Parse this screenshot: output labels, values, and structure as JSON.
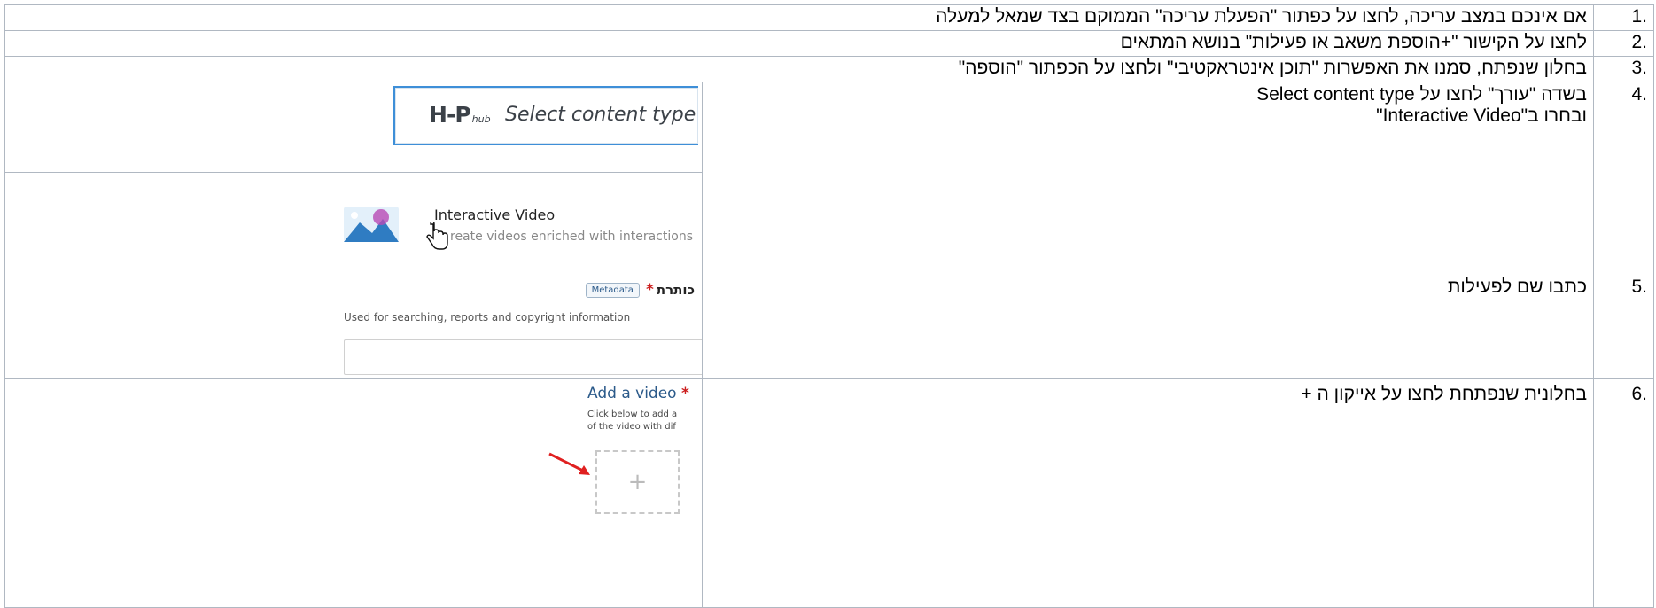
{
  "steps": [
    {
      "number": "1.",
      "text": "אם אינכם במצב עריכה, לחצו על כפתור \"הפעלת עריכה\" הממוקם בצד שמאל למעלה"
    },
    {
      "number": "2.",
      "text": "לחצו על הקישור \"+הוספת משאב או פעילות\" בנושא המתאים"
    },
    {
      "number": "3.",
      "text": "בחלון שנפתח, סמנו את האפשרות \"תוכן אינטראקטיבי\" ולחצו על הכפתור \"הוספה\""
    },
    {
      "number": "4.",
      "text_line1": "בשדה \"עורך\" לחצו על Select content type",
      "text_line2": "ובחרו ב\"Interactive Video\""
    },
    {
      "number": "5.",
      "text": "כתבו שם לפעילות"
    },
    {
      "number": "6.",
      "text": "בחלונית שנפתחת לחצו על אייקון ה +"
    }
  ],
  "screenshots": {
    "hub": {
      "logo_h": "H",
      "logo_p": "P",
      "logo_sub": "hub",
      "select_text": "Select content type"
    },
    "iv": {
      "title": "Interactive Video",
      "desc": "reate videos enriched with interactions"
    },
    "title_field": {
      "label": "כותרת",
      "required": "*",
      "badge": "Metadata",
      "help": "Used for searching, reports and copyright information"
    },
    "video": {
      "label": "Add a video",
      "required": "*",
      "line1": "Click below to add a",
      "line2": "of the video with dif",
      "plus": "+"
    }
  },
  "colors": {
    "border": "#b0b8c2",
    "link_blue": "#2b5a8a",
    "required_red": "#cc1f1f",
    "arrow_red": "#e02020",
    "hub_border": "#3e8fd8"
  }
}
